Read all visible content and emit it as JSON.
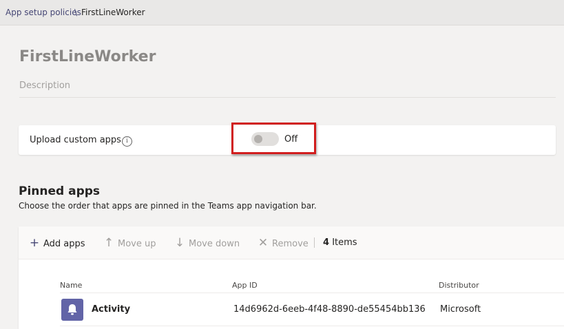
{
  "breadcrumb": {
    "parent": "App setup policies",
    "separator": "\\",
    "current": "FirstLineWorker"
  },
  "policy": {
    "title": "FirstLineWorker",
    "description_placeholder": "Description"
  },
  "upload_custom_apps": {
    "label": "Upload custom apps",
    "info_icon": "i",
    "toggle_state": "Off",
    "toggle_on": false
  },
  "pinned_apps": {
    "title": "Pinned apps",
    "subtitle": "Choose the order that apps are pinned in the Teams app navigation bar.",
    "toolbar": {
      "add_label": "Add apps",
      "move_up_label": "Move up",
      "move_down_label": "Move down",
      "remove_label": "Remove",
      "count_number": "4",
      "count_label": "Items"
    },
    "columns": {
      "name": "Name",
      "app_id": "App ID",
      "distributor": "Distributor"
    },
    "rows": [
      {
        "icon": "bell-icon",
        "name": "Activity",
        "app_id": "14d6962d-6eeb-4f48-8890-de55454bb136",
        "distributor": "Microsoft"
      }
    ]
  },
  "colors": {
    "accent": "#6264a7",
    "highlight": "#d11d1d",
    "background": "#f3f2f1"
  }
}
